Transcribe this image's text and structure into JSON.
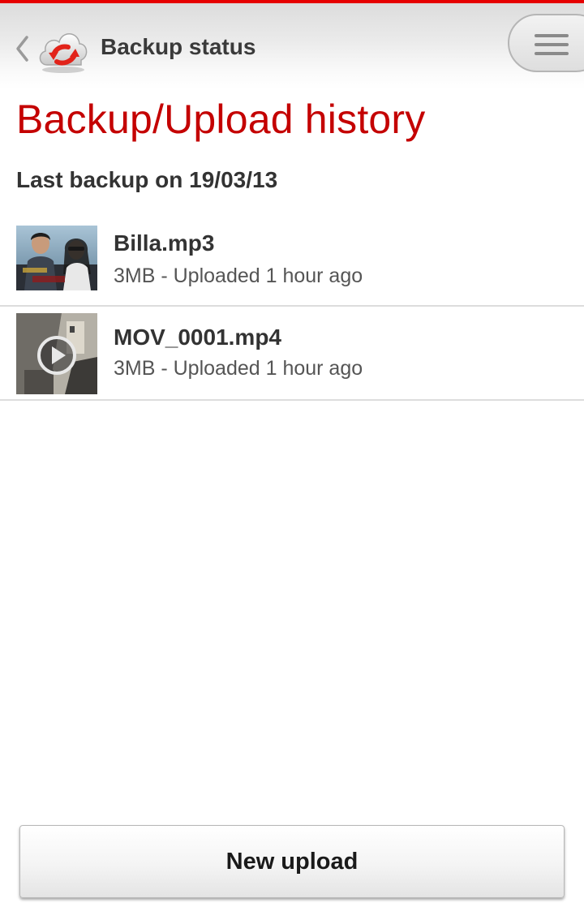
{
  "header": {
    "title": "Backup status",
    "back_icon": "chevron-left-icon",
    "app_icon": "cloud-sync-icon",
    "menu_icon": "hamburger-menu-icon"
  },
  "main": {
    "heading": "Backup/Upload history",
    "last_backup": "Last backup on 19/03/13",
    "items": [
      {
        "name": "Billa.mp3",
        "meta": "3MB - Uploaded 1 hour ago",
        "thumbnail": "album-art-thumbnail"
      },
      {
        "name": "MOV_0001.mp4",
        "meta": "3MB - Uploaded 1 hour ago",
        "thumbnail": "video-thumbnail",
        "overlay_icon": "play-icon"
      }
    ]
  },
  "footer": {
    "new_upload_label": "New upload"
  },
  "colors": {
    "accent": "#e60000",
    "heading": "#c40000",
    "text_primary": "#333333",
    "text_secondary": "#555555",
    "divider": "#dddddd"
  }
}
